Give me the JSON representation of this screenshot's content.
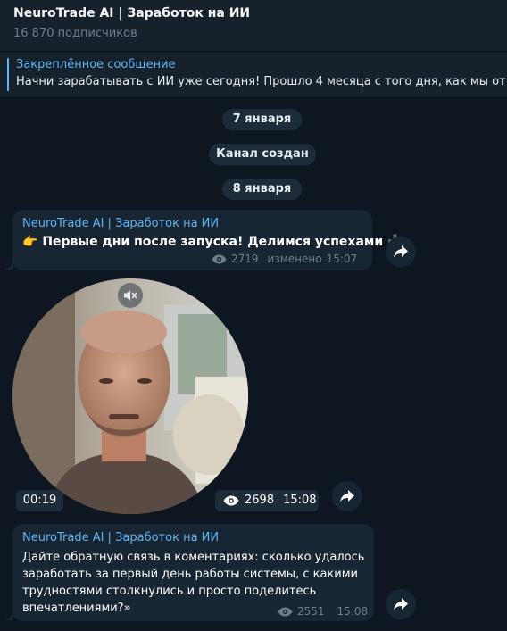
{
  "header": {
    "title": "NeuroTrade AI | Заработок на ИИ",
    "subscribers": "16 870 подписчиков"
  },
  "pinned": {
    "label": "Закреплённое сообщение",
    "text": "Начни зарабатывать с ИИ уже сегодня!  Прошло 4 месяца с того дня, как мы от"
  },
  "dates": {
    "first": "7 января",
    "service": "Канал создан",
    "second": "8 января"
  },
  "messages": [
    {
      "sender": "NeuroTrade AI | Заработок на ИИ",
      "emoji_left": "👉",
      "text": "Первые дни после запуска! Делимся успехами",
      "emoji_right": "➕",
      "views": "2719",
      "edited": "изменено",
      "time": "15:07"
    },
    {
      "duration": "00:19",
      "views": "2698",
      "time": "15:08"
    },
    {
      "sender": "NeuroTrade AI | Заработок на ИИ",
      "lines": [
        "Дайте обратную связь в коментариях: сколько удалось",
        "заработать за первый день работы системы, с какими",
        "трудностями столкнулись и просто поделитесь",
        "впечатлениями?»"
      ],
      "views": "2551",
      "time": "15:08"
    }
  ],
  "icons": {
    "eye": "eye-icon",
    "share": "share-icon",
    "mute": "mute-icon"
  },
  "colors": {
    "background": "#0e1621",
    "header": "#17212b",
    "bubble": "#182533",
    "accent": "#5eb5f7",
    "muted": "#6d7f8f"
  }
}
